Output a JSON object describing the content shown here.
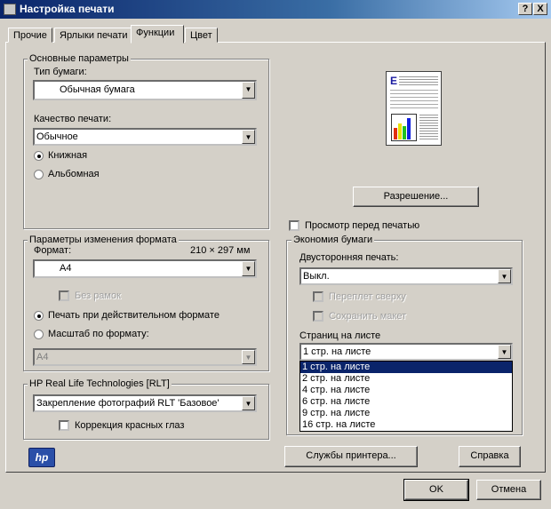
{
  "window": {
    "title": "Настройка печати",
    "help_btn": "?",
    "close_btn": "X"
  },
  "tabs": [
    {
      "label": "Прочие"
    },
    {
      "label": "Ярлыки печати"
    },
    {
      "label": "Функции"
    },
    {
      "label": "Цвет"
    }
  ],
  "basic": {
    "title": "Основные параметры",
    "paper_type_label": "Тип бумаги:",
    "paper_type": "Обычная бумага",
    "quality_label": "Качество печати:",
    "quality": "Обычное",
    "portrait": "Книжная",
    "landscape": "Альбомная"
  },
  "resize": {
    "title": "Параметры изменения формата",
    "format_label": "Формат:",
    "size_text": "210 × 297 мм",
    "format": "A4",
    "borderless": "Без рамок",
    "actual_size": "Печать при действительном формате",
    "scale": "Масштаб по формату:",
    "scale_value": "A4"
  },
  "rlt": {
    "title": "HP Real Life Technologies [RLT]",
    "mode": "Закрепление фотографий RLT 'Базовое'",
    "redeye": "Коррекция красных глаз"
  },
  "preview": {
    "resolution_btn": "Разрешение...",
    "preview_checkbox": "Просмотр перед печатью"
  },
  "economy": {
    "title": "Экономия бумаги",
    "duplex_label": "Двусторонняя печать:",
    "duplex": "Выкл.",
    "flip_top": "Переплет сверху",
    "keep_layout": "Сохранить макет",
    "pages_label": "Страниц на листе",
    "pages": "1 стр. на листе",
    "options": [
      "1 стр. на листе",
      "2 стр. на листе",
      "4 стр. на листе",
      "6 стр. на листе",
      "9 стр. на листе",
      "16 стр. на листе"
    ]
  },
  "footer": {
    "logo": "hp",
    "services_btn": "Службы принтера...",
    "help_btn": "Справка",
    "ok": "OK",
    "cancel": "Отмена"
  }
}
